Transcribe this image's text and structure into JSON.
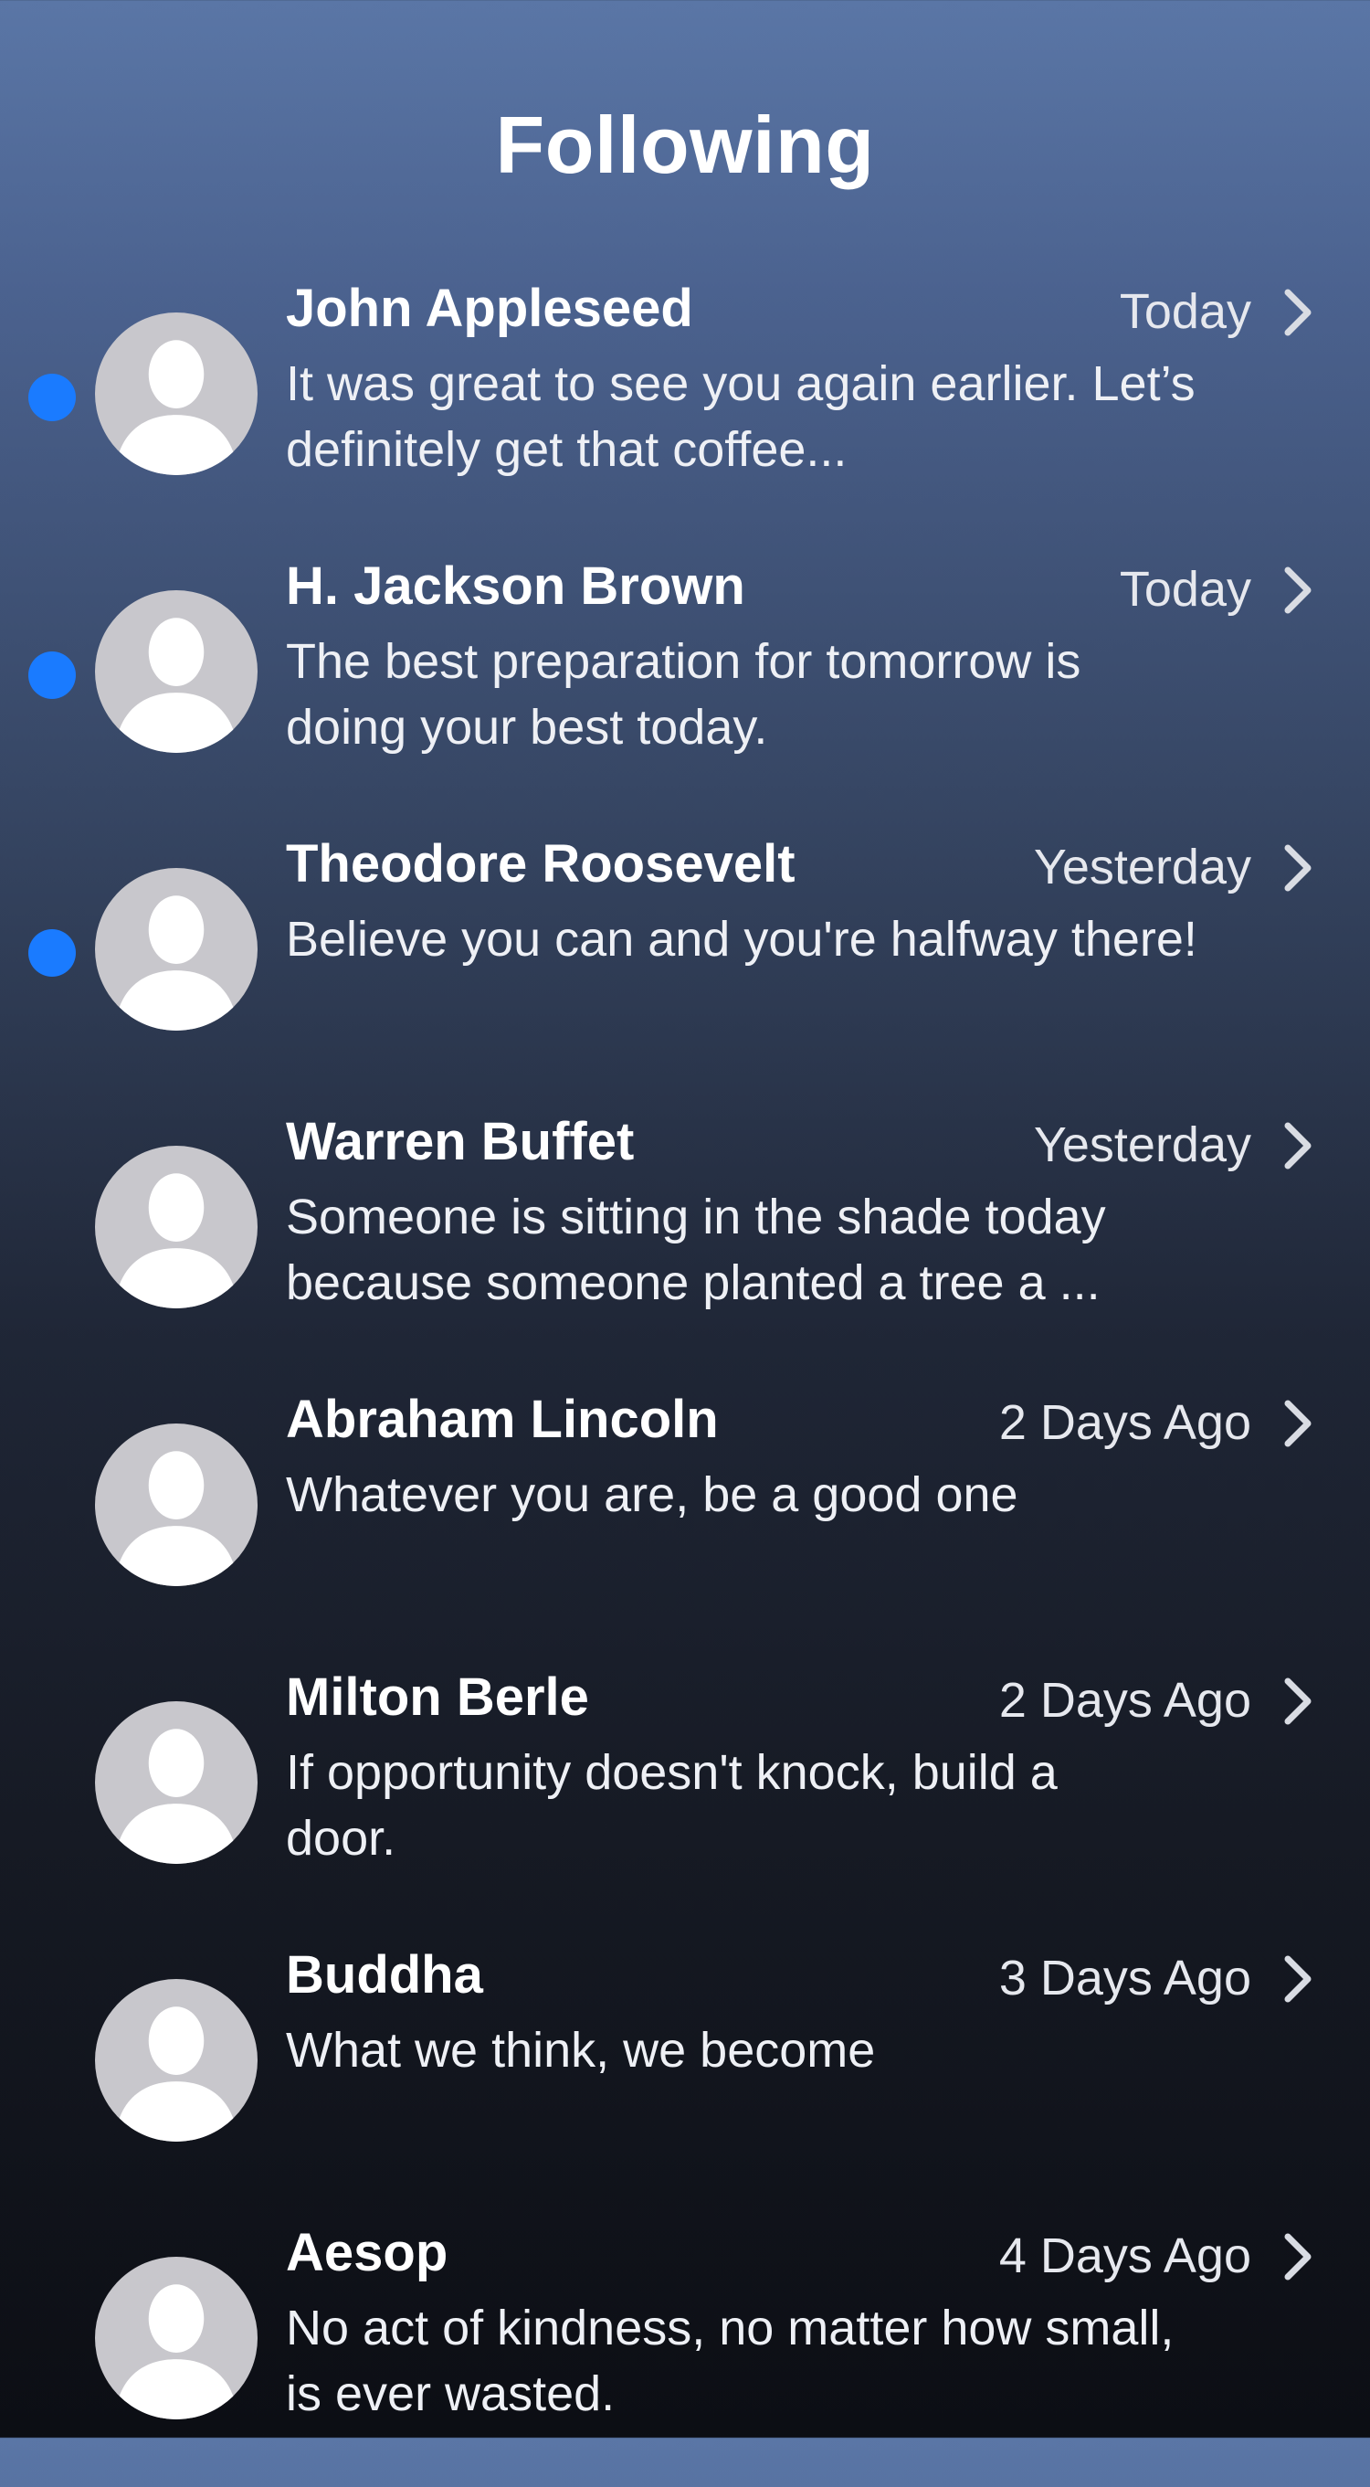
{
  "header": {
    "title": "Following"
  },
  "colors": {
    "unread_dot": "#1a7bff",
    "avatar_bg": "#c8c7cc"
  },
  "icons": {
    "avatar": "person-silhouette-icon",
    "disclosure": "chevron-right-icon",
    "unread": "unread-dot-icon"
  },
  "messages": [
    {
      "name": "John Appleseed",
      "time": "Today",
      "preview": "It was great to see you again earlier. Let’s\ndefinitely get that coffee...",
      "unread": true
    },
    {
      "name": "H. Jackson Brown",
      "time": "Today",
      "preview": "The best preparation for tomorrow is\ndoing your best today.",
      "unread": true
    },
    {
      "name": "Theodore Roosevelt",
      "time": "Yesterday",
      "preview": "Believe you can and you're halfway there!",
      "unread": true
    },
    {
      "name": "Warren Buffet",
      "time": "Yesterday",
      "preview": "Someone is sitting in the shade today\nbecause someone planted a tree a  ...",
      "unread": false
    },
    {
      "name": "Abraham Lincoln",
      "time": "2 Days Ago",
      "preview": "Whatever you are, be a good one",
      "unread": false
    },
    {
      "name": "Milton Berle",
      "time": "2 Days  Ago",
      "preview": " If opportunity doesn't knock, build a\ndoor.",
      "unread": false
    },
    {
      "name": "Buddha",
      "time": "3 Days Ago",
      "preview": "What we think, we become",
      "unread": false
    },
    {
      "name": "Aesop",
      "time": "4 Days Ago",
      "preview": "No act of kindness, no matter how small,\nis ever wasted.",
      "unread": false
    }
  ]
}
